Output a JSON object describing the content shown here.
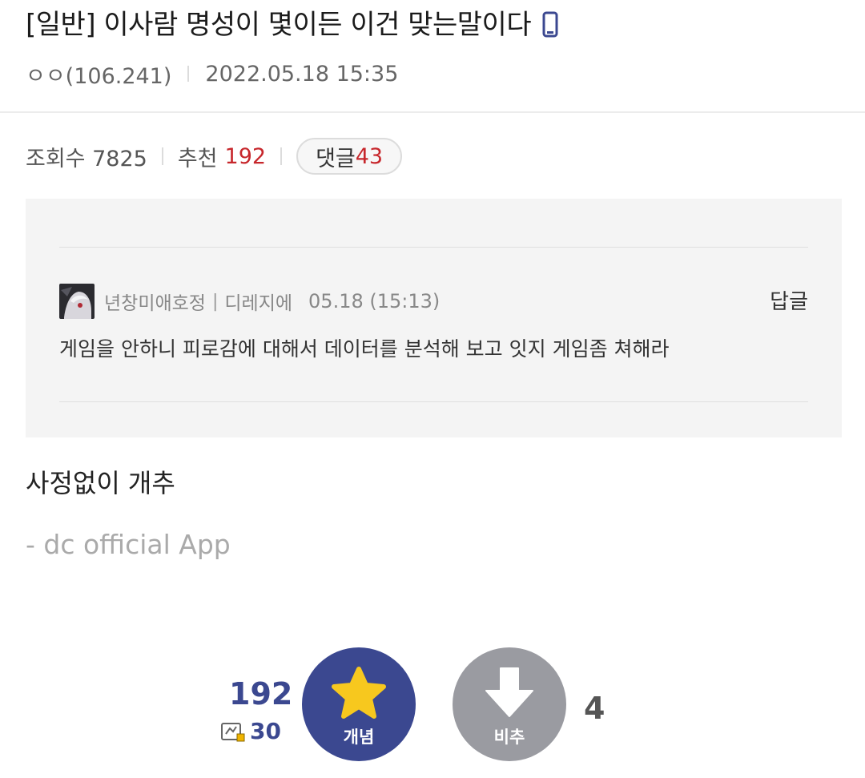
{
  "post": {
    "title": "[일반] 이사람 명성이 몇이든 이건 맞는말이다",
    "author": "ㅇㅇ(106.241)",
    "date": "2022.05.18 15:35",
    "stats": {
      "views_label": "조회수 7825",
      "recommend_label": "추천",
      "recommend_count": "192",
      "comments_label": "댓글",
      "comments_count": "43"
    }
  },
  "quoted_comment": {
    "nickname": "년창미애호정",
    "separator": "|",
    "gallery": "디레지에",
    "date": "05.18 (15:13)",
    "reply_label": "답글",
    "text": "게임을 안하니 피로감에 대해서 데이터를 분석해 보고 잇지 게임좀 쳐해라"
  },
  "body": {
    "text": "사정없이 개추",
    "app_signature": "- dc official App"
  },
  "votes": {
    "up_count": "192",
    "fixed_count": "30",
    "up_label": "개념",
    "down_label": "비추",
    "down_count": "4",
    "colors": {
      "up": "#3b4890",
      "down": "#9a9ba1",
      "star": "#f7c81e",
      "count_red": "#c7272c"
    }
  },
  "icons": [
    "mobile-icon",
    "avatar-image",
    "fixed-user-icon",
    "star-icon",
    "arrow-down-icon"
  ]
}
